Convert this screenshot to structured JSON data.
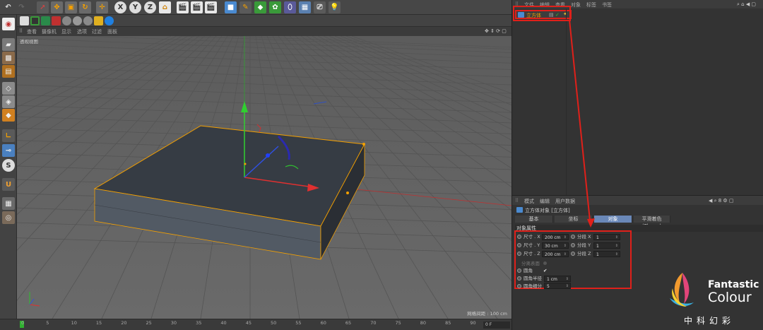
{
  "viewport_menu": [
    "查看",
    "摄像机",
    "显示",
    "选项",
    "过滤",
    "面板"
  ],
  "viewport_label": "透视视图",
  "grid_spacing": "网格间距 : 100 cm",
  "timeline": {
    "ticks": [
      "0",
      "5",
      "10",
      "15",
      "20",
      "25",
      "30",
      "35",
      "40",
      "45",
      "50",
      "55",
      "60",
      "65",
      "70",
      "75",
      "80",
      "85",
      "90"
    ],
    "frame": "0 F"
  },
  "object_manager": {
    "menu": [
      "文件",
      "编辑",
      "查看",
      "对象",
      "标签",
      "书签"
    ],
    "object_name": "立方体"
  },
  "attributes": {
    "menu": [
      "模式",
      "编辑",
      "用户数据"
    ],
    "title": "立方体对象 [立方体]",
    "tabs": [
      "基本",
      "坐标",
      "对象",
      "平滑着色(Phong)"
    ],
    "active_tab": "对象",
    "section": "对象属性",
    "props": {
      "size_x_label": "尺寸 . X",
      "size_x": "200 cm",
      "size_y_label": "尺寸 . Y",
      "size_y": "30 cm",
      "size_z_label": "尺寸 . Z",
      "size_z": "200 cm",
      "seg_x_label": "分段 X",
      "seg_x": "1",
      "seg_y_label": "分段 Y",
      "seg_y": "1",
      "seg_z_label": "分段 Z",
      "seg_z": "1",
      "separate_label": "分离表面",
      "fillet_label": "圆角",
      "fillet_check": "✔",
      "fillet_radius_label": "圆角半径",
      "fillet_radius": "1 cm",
      "fillet_sub_label": "圆角细分",
      "fillet_sub": "5"
    }
  },
  "brand": {
    "line1": "Fantastic",
    "line2": "Colour",
    "line3": "中科幻彩"
  },
  "colors": {
    "accent_orange": "#f4a000",
    "highlight_red": "#e0201a",
    "axis_x": "#e03030",
    "axis_y": "#30c030",
    "axis_z": "#3050e0"
  }
}
